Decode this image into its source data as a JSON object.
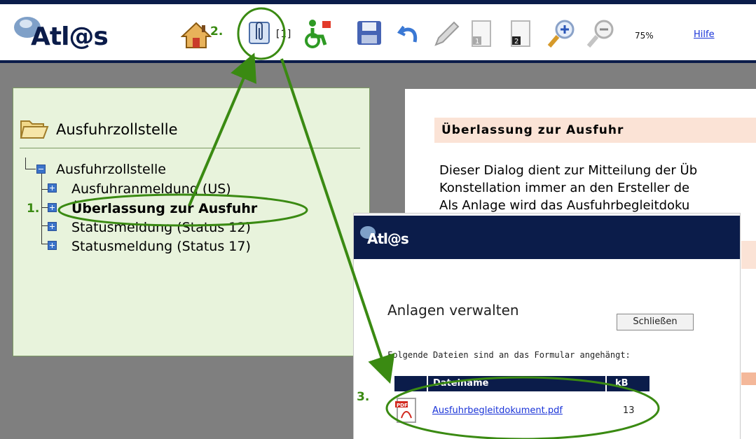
{
  "app": {
    "logo_text": "Atl@s"
  },
  "toolbar": {
    "attachment_count": "[1]",
    "zoom_level": "75%",
    "help_label": "Hilfe",
    "icons": [
      "home-icon",
      "attachment-icon",
      "accessibility-icon",
      "save-icon",
      "undo-icon",
      "pencil-icon",
      "page-1-icon",
      "page-2-icon",
      "zoom-in-icon",
      "zoom-out-icon"
    ]
  },
  "sidebar": {
    "title": "Ausfuhrzollstelle",
    "root_label": "Ausfuhrzollstelle",
    "items": [
      {
        "label": "Ausfuhranmeldung  (US)",
        "selected": false
      },
      {
        "label": "Überlassung zur Ausfuhr",
        "selected": true
      },
      {
        "label": "Statusmeldung (Status 12)",
        "selected": false
      },
      {
        "label": "Statusmeldung (Status 17)",
        "selected": false
      }
    ]
  },
  "document": {
    "heading": "Überlassung zur Ausfuhr",
    "lines": [
      "Dieser Dialog dient zur Mitteilung der Üb",
      "Konstellation immer an den Ersteller de",
      "Als Anlage wird das Ausfuhrbegleitdoku"
    ]
  },
  "popup": {
    "logo_text": "Atl@s",
    "title": "Anlagen verwalten",
    "close_label": "Schließen",
    "info_text": "Folgende Dateien sind an das Formular angehängt:",
    "table": {
      "headers": [
        "Dateiname",
        "kB"
      ],
      "rows": [
        {
          "name": "Ausfuhrbegleitdokument.pdf",
          "size": "13"
        }
      ]
    }
  },
  "annotations": {
    "step1": "1.",
    "step2": "2.",
    "step3": "3.",
    "color": "#3a8a12"
  }
}
